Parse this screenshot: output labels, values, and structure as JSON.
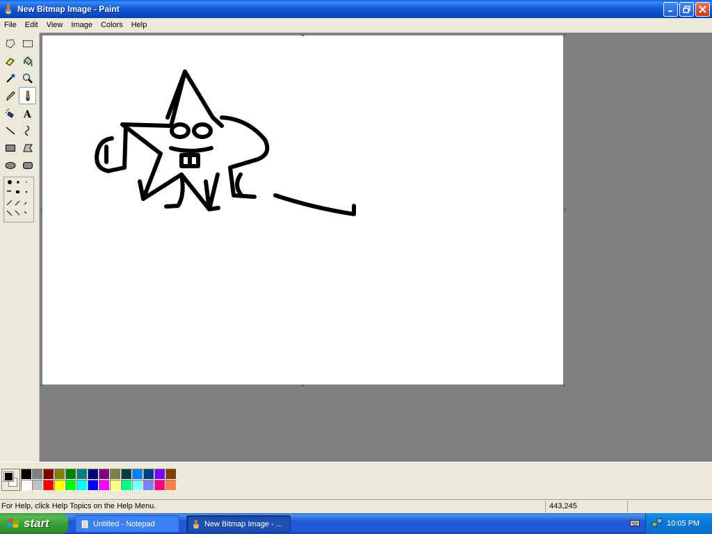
{
  "window": {
    "title": "New Bitmap Image - Paint"
  },
  "menu": [
    "File",
    "Edit",
    "View",
    "Image",
    "Colors",
    "Help"
  ],
  "tools": [
    {
      "name": "free-form-select-tool-icon"
    },
    {
      "name": "select-tool-icon"
    },
    {
      "name": "eraser-tool-icon"
    },
    {
      "name": "fill-tool-icon"
    },
    {
      "name": "pick-color-tool-icon"
    },
    {
      "name": "magnifier-tool-icon"
    },
    {
      "name": "pencil-tool-icon"
    },
    {
      "name": "brush-tool-icon"
    },
    {
      "name": "airbrush-tool-icon"
    },
    {
      "name": "text-tool-icon"
    },
    {
      "name": "line-tool-icon"
    },
    {
      "name": "curve-tool-icon"
    },
    {
      "name": "rectangle-tool-icon"
    },
    {
      "name": "polygon-tool-icon"
    },
    {
      "name": "ellipse-tool-icon"
    },
    {
      "name": "rounded-rectangle-tool-icon"
    }
  ],
  "active_tool": "brush",
  "colors": {
    "foreground": "#000000",
    "background": "#ffffff",
    "palette_row1": [
      "#000000",
      "#808080",
      "#800000",
      "#808000",
      "#008000",
      "#008080",
      "#000080",
      "#800080",
      "#808040",
      "#004040",
      "#0080ff",
      "#004080",
      "#8000ff",
      "#804000"
    ],
    "palette_row2": [
      "#ffffff",
      "#c0c0c0",
      "#ff0000",
      "#ffff00",
      "#00ff00",
      "#00ffff",
      "#0000ff",
      "#ff00ff",
      "#ffff80",
      "#00ff80",
      "#80ffff",
      "#8080ff",
      "#ff0080",
      "#ff8040"
    ]
  },
  "status": {
    "help": "For Help, click Help Topics on the Help Menu.",
    "coords": "443,245"
  },
  "taskbar": {
    "start": "start",
    "tasks": [
      {
        "label": "Untitled - Notepad",
        "active": false
      },
      {
        "label": "New Bitmap Image - ...",
        "active": true
      }
    ],
    "clock": "10:05 PM"
  }
}
